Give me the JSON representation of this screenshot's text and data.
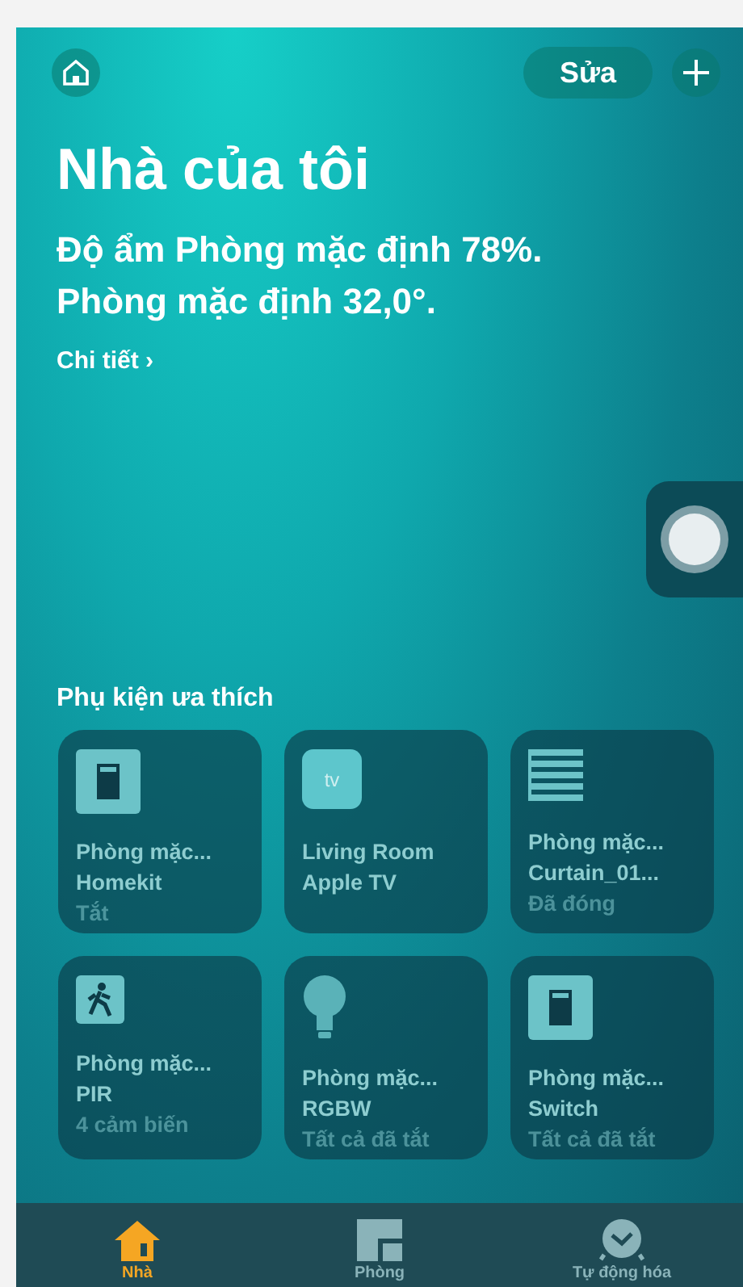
{
  "header": {
    "edit_button": "Sửa"
  },
  "title": "Nhà của tôi",
  "summary_lines": [
    "Độ ẩm Phòng mặc định 78%.",
    "Phòng mặc định 32,0°."
  ],
  "details_link": "Chi tiết ›",
  "favorites": {
    "heading": "Phụ kiện ưa thích",
    "tiles": [
      {
        "kind": "switch",
        "room": "Phòng mặc...",
        "name": "Homekit",
        "status": "Tắt"
      },
      {
        "kind": "tv",
        "icon_label": "tv",
        "room": "Living Room",
        "name": "Apple TV"
      },
      {
        "kind": "curtain",
        "room": "Phòng mặc...",
        "name": "Curtain_01...",
        "status": "Đã đóng"
      },
      {
        "kind": "sensor",
        "room": "Phòng mặc...",
        "name": "PIR",
        "status": "4 cảm biến"
      },
      {
        "kind": "bulb",
        "room": "Phòng mặc...",
        "name": "RGBW",
        "status": "Tất cả đã tắt"
      },
      {
        "kind": "switch",
        "room": "Phòng mặc...",
        "name": "Switch",
        "status": "Tất cả đã tắt"
      }
    ]
  },
  "tab_bar": [
    {
      "kind": "home",
      "label": "Nhà",
      "selected": true
    },
    {
      "kind": "rooms",
      "label": "Phòng",
      "selected": false
    },
    {
      "kind": "automation",
      "label": "Tự động hóa",
      "selected": false
    }
  ]
}
